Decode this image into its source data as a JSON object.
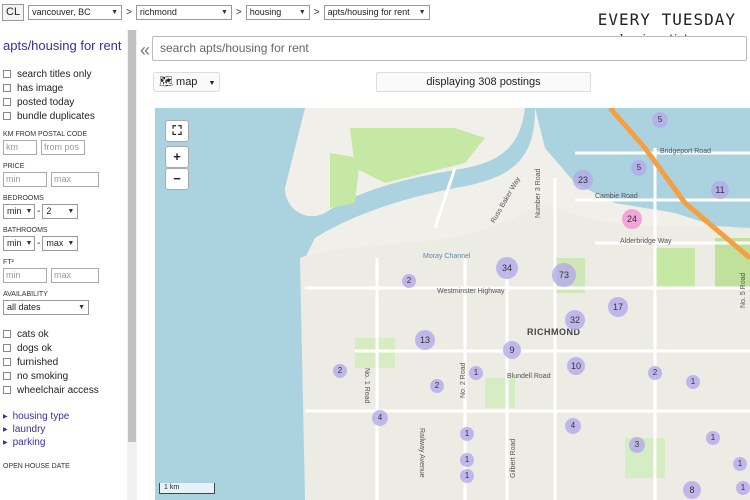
{
  "topbar": {
    "logo": "CL",
    "location": "vancouver, BC",
    "subarea": "richmond",
    "category": "housing",
    "subcategory": "apts/housing for rent"
  },
  "brand": {
    "title": "EVERY TUESDAY",
    "site": "hanimu.tistory.com"
  },
  "sidebar": {
    "title": "apts/housing for rent",
    "options": [
      "search titles only",
      "has image",
      "posted today",
      "bundle duplicates"
    ],
    "km_label": "KM FROM POSTAL CODE",
    "km_placeholder": "km",
    "postal_placeholder": "from pos",
    "price_label": "PRICE",
    "min_placeholder": "min",
    "max_placeholder": "max",
    "bedrooms_label": "BEDROOMS",
    "bedrooms_min": "min",
    "bedrooms_max": "2",
    "bathrooms_label": "BATHROOMS",
    "bathrooms_min": "min",
    "bathrooms_max": "max",
    "ft_label": "FT²",
    "availability_label": "AVAILABILITY",
    "availability_value": "all dates",
    "amenities": [
      "cats ok",
      "dogs ok",
      "furnished",
      "no smoking",
      "wheelchair access"
    ],
    "links": [
      "housing type",
      "laundry",
      "parking"
    ],
    "open_house_label": "OPEN HOUSE DATE"
  },
  "main": {
    "collapse_icon": "«",
    "search_placeholder": "search apts/housing for rent",
    "view_label": "map",
    "displaying": "displaying 308 postings"
  },
  "map": {
    "city": "RICHMOND",
    "scale": "1 km",
    "roads": [
      {
        "label": "Westminster Highway"
      },
      {
        "label": "Bridgeport Road"
      },
      {
        "label": "Cambie Road"
      },
      {
        "label": "Alderbridge Way"
      },
      {
        "label": "Blundell Road"
      },
      {
        "label": "Number 3 Road"
      },
      {
        "label": "No. 1 Road"
      },
      {
        "label": "No. 2 Road"
      },
      {
        "label": "Gilbert Road"
      },
      {
        "label": "Railway Avenue"
      },
      {
        "label": "Moray Channel"
      },
      {
        "label": "Russ Baker Way"
      },
      {
        "label": "No. 5 Road"
      }
    ],
    "clusters": [
      5,
      23,
      5,
      11,
      24,
      34,
      73,
      2,
      17,
      32,
      13,
      9,
      10,
      2,
      2,
      2,
      1,
      1,
      1,
      4,
      4,
      1,
      1,
      3,
      1,
      1,
      8,
      1
    ]
  }
}
